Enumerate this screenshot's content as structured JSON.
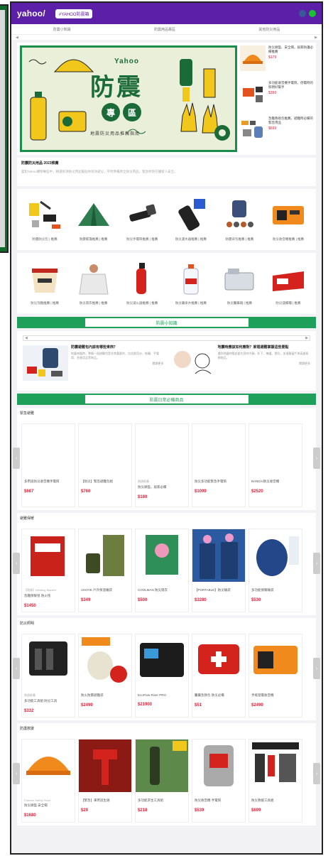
{
  "header": {
    "logo": "yahoo/",
    "tag": "#YAHOO防震箱",
    "icons": [
      "facebook-icon",
      "line-icon"
    ]
  },
  "subnav": [
    "防震小知識",
    "防震用品專區",
    "其他防災用品"
  ],
  "hero": {
    "brand": "Yahoo",
    "title": "防震",
    "badge": [
      "專",
      "區"
    ],
    "subtitle": "地震防災用品推薦指南",
    "side_items": [
      {
        "text": "防災頭盔、安全帽，居家防護必備推薦",
        "price": "$179"
      },
      {
        "text": "多功能收音機手電筒，停電時的照明好幫手",
        "price": "$399"
      },
      {
        "text": "急難救助包推薦，避難時必備的緊急用品",
        "price": "$699"
      }
    ]
  },
  "notice": {
    "title": "防震防災用品 2023推薦",
    "desc": "面對Yahoo購物專區中，精選各項防災用品幫助你有效避災，平時準備齊全防災用品，緊急時刻守護家人安全。"
  },
  "row1": [
    {
      "cap": "防震防災包 | 推薦",
      "icon": "tools-icon"
    },
    {
      "cap": "防震帳篷推薦 | 推薦",
      "icon": "tent-icon"
    },
    {
      "cap": "防災手電筒推薦 | 推薦",
      "icon": "flashlight-icon"
    },
    {
      "cap": "防災濾水器推薦 | 推薦",
      "icon": "water-filter-icon"
    },
    {
      "cap": "防震背包推薦 | 推薦",
      "icon": "backpack-icon"
    },
    {
      "cap": "防災收音機推薦 | 推薦",
      "icon": "radio-icon"
    }
  ],
  "row2": [
    {
      "cap": "防災泡麵推薦 | 推薦",
      "icon": "noodle-icon"
    },
    {
      "cap": "防災雨衣推薦 | 推薦",
      "icon": "raincoat-icon"
    },
    {
      "cap": "防災滅火器推薦 | 推薦",
      "icon": "extinguisher-icon"
    },
    {
      "cap": "防災礦泉水推薦 | 推薦",
      "icon": "water-bottle-icon"
    },
    {
      "cap": "防災醫藥箱 | 推薦",
      "icon": "medkit-icon"
    },
    {
      "cap": "防災儲備糧 | 推薦",
      "icon": "food-box-icon"
    }
  ],
  "knowledge": {
    "header": "防震小知識",
    "items": [
      {
        "title": "防震避難包內該有哪些東西？",
        "desc": "地震來臨時，準備一個避難包是非常重要的，包含飲用水、乾糧、手電筒、急救用品等物品。",
        "more": "閱讀更多"
      },
      {
        "title": "地震時應該如何應對？家裡避難掌握這些要點",
        "desc": "遇到地震時應該要先保持冷靜，趴下、掩護、穩住，並遠離窗戶與高處易倒物品。",
        "more": "閱讀更多"
      }
    ]
  },
  "shop_header": "防震日常必備商品",
  "sections": [
    {
      "title": "緊急避難",
      "cards": [
        {
          "tag": "",
          "name": "多用途防災收音機手電筒",
          "price": "$687"
        },
        {
          "tag": "",
          "name": "【防災】緊急避難包組",
          "price": "$760"
        },
        {
          "tag": "熱銷推薦",
          "name": "防災頭盔，居家必備",
          "price": "$180"
        },
        {
          "tag": "",
          "name": "防災多功能緊急手電筒",
          "price": "$1099"
        },
        {
          "tag": "",
          "name": "BANDAI防災收音機",
          "price": "$2520"
        }
      ]
    },
    {
      "title": "避難保暖",
      "cards": [
        {
          "tag": "【現貨】Welding Blanket",
          "name": "急難保暖毯 防火毯",
          "price": "$1450"
        },
        {
          "tag": "",
          "name": "AHOYE 戶外保溫睡袋",
          "price": "$349"
        },
        {
          "tag": "",
          "name": "COOLMAN 防災雨衣",
          "price": "$500"
        },
        {
          "tag": "",
          "name": "【PORTABLE】防災睡袋",
          "price": "$3280"
        },
        {
          "tag": "",
          "name": "多功能保暖睡袋",
          "price": "$530"
        }
      ]
    },
    {
      "title": "防災照明",
      "cards": [
        {
          "tag": "熱銷推薦",
          "name": "多功能工具組 防災工具",
          "price": "$332"
        },
        {
          "tag": "",
          "name": "防火防震避難袋",
          "price": "$2499"
        },
        {
          "tag": "",
          "name": "EcoFlow River PRO",
          "price": "$21900"
        },
        {
          "tag": "",
          "name": "醫藥急救包 防災必備",
          "price": "$51"
        },
        {
          "tag": "",
          "name": "手搖發電收音機",
          "price": "$2499"
        }
      ]
    },
    {
      "title": "防護救援",
      "cards": [
        {
          "tag": "Fashion Safety Hood",
          "name": "防災頭盔 安全帽",
          "price": "$1680"
        },
        {
          "tag": "",
          "name": "【緊急】車用逃生錘",
          "price": "$29"
        },
        {
          "tag": "",
          "name": "多功能求生工具組",
          "price": "$218"
        },
        {
          "tag": "",
          "name": "防災收音機 手電筒",
          "price": "$539"
        },
        {
          "tag": "",
          "name": "防災救援工具組",
          "price": "$699"
        }
      ]
    }
  ],
  "colors": {
    "purple": "#5b1fa8",
    "green": "#1fa05a",
    "red": "#e0203a"
  }
}
